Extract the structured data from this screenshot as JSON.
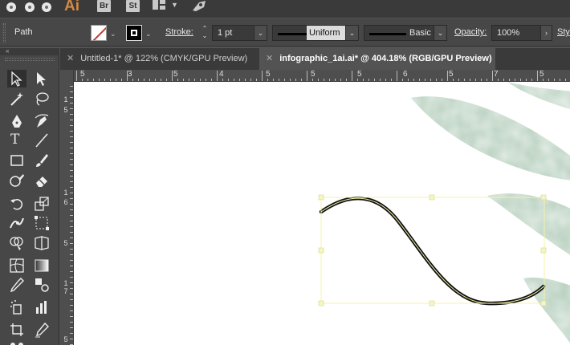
{
  "app": {
    "logo": "Ai",
    "bridge_label": "Br",
    "stock_label": "St"
  },
  "control_bar": {
    "selection_label": "Path",
    "stroke_label": "Stroke:",
    "stroke_weight": "1 pt",
    "profile_name": "Uniform",
    "brush_name": "Basic",
    "opacity_label": "Opacity:",
    "opacity_value": "100%",
    "style_label": "Sty"
  },
  "tabs": [
    {
      "label": "Untitled-1* @ 122% (CMYK/GPU Preview)",
      "active": false
    },
    {
      "label": "infographic_1ai.ai* @ 404.18% (RGB/GPU Preview)",
      "active": true
    }
  ],
  "toolpanel": {
    "collapse_label": "«"
  },
  "ruler": {
    "top_labels": [
      "5",
      "3",
      "5",
      "4",
      "5",
      "5",
      "5",
      "6",
      "5",
      "7",
      "5"
    ],
    "left_labels": [
      "1",
      "5",
      "1",
      "6",
      "5",
      "1",
      "7",
      "5"
    ]
  },
  "colors": {
    "ui_dark": "#3a3a3a",
    "ui_panel": "#474747",
    "selection_box": "#f3f3a8",
    "leaf_green": "#8fb59a",
    "path_stroke": "#111111",
    "app_accent": "#d38a43"
  },
  "icons": [
    "selection-tool-icon",
    "direct-selection-tool-icon",
    "magic-wand-icon",
    "lasso-icon",
    "pen-icon",
    "curvature-icon",
    "type-icon",
    "line-segment-icon",
    "rectangle-icon",
    "paintbrush-icon",
    "shaper-icon",
    "eraser-icon",
    "rotate-icon",
    "scale-icon",
    "width-icon",
    "free-transform-icon",
    "shape-builder-icon",
    "perspective-icon",
    "mesh-icon",
    "gradient-icon",
    "eyedropper-icon",
    "blend-icon",
    "symbol-sprayer-icon",
    "column-graph-icon",
    "artboard-icon",
    "slice-icon"
  ]
}
